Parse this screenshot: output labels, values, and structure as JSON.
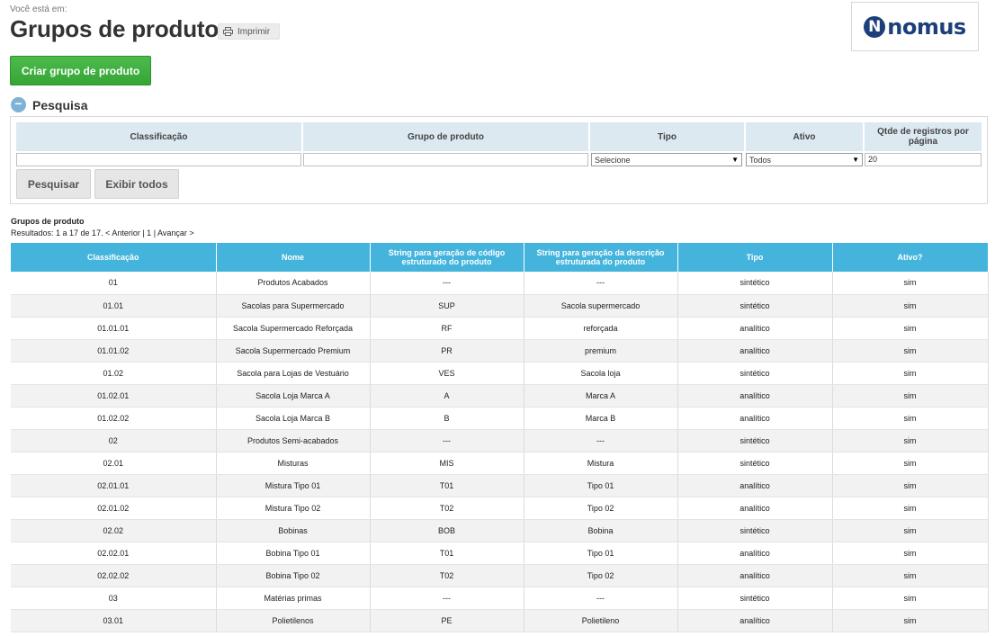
{
  "breadcrumb": "Você está em:",
  "title": "Grupos de produto",
  "print_label": "Imprimir",
  "logo_letter": "N",
  "logo_text": "nomus",
  "create_button": "Criar grupo de produto",
  "search": {
    "collapse_symbol": "−",
    "title": "Pesquisa",
    "labels": {
      "classificacao": "Classificação",
      "grupo": "Grupo de produto",
      "tipo": "Tipo",
      "ativo": "Ativo",
      "qtde": "Qtde de registros por página"
    },
    "values": {
      "classificacao": "",
      "grupo": "",
      "tipo": "Selecione",
      "ativo": "Todos",
      "qtde": "20"
    },
    "search_button": "Pesquisar",
    "show_all_button": "Exibir todos"
  },
  "results": {
    "title": "Grupos de produto",
    "summary": "Resultados: 1 a 17 de 17. < Anterior | 1 | Avançar >"
  },
  "table": {
    "headers": [
      "Classificação",
      "Nome",
      "String para geração de código estruturado do produto",
      "String para geração da descrição estruturada do produto",
      "Tipo",
      "Ativo?"
    ],
    "rows": [
      [
        "01",
        "Produtos Acabados",
        "---",
        "---",
        "sintético",
        "sim"
      ],
      [
        "01.01",
        "Sacolas para Supermercado",
        "SUP",
        "Sacola supermercado",
        "sintético",
        "sim"
      ],
      [
        "01.01.01",
        "Sacola Supermercado Reforçada",
        "RF",
        "reforçada",
        "analítico",
        "sim"
      ],
      [
        "01.01.02",
        "Sacola Supermercado Premium",
        "PR",
        "premium",
        "analítico",
        "sim"
      ],
      [
        "01.02",
        "Sacola para Lojas de Vestuário",
        "VES",
        "Sacola loja",
        "sintético",
        "sim"
      ],
      [
        "01.02.01",
        "Sacola Loja Marca A",
        "A",
        "Marca A",
        "analítico",
        "sim"
      ],
      [
        "01.02.02",
        "Sacola Loja Marca B",
        "B",
        "Marca B",
        "analítico",
        "sim"
      ],
      [
        "02",
        "Produtos Semi-acabados",
        "---",
        "---",
        "sintético",
        "sim"
      ],
      [
        "02.01",
        "Misturas",
        "MIS",
        "Mistura",
        "sintético",
        "sim"
      ],
      [
        "02.01.01",
        "Mistura Tipo 01",
        "T01",
        "Tipo 01",
        "analítico",
        "sim"
      ],
      [
        "02.01.02",
        "Mistura Tipo 02",
        "T02",
        "Tipo 02",
        "analítico",
        "sim"
      ],
      [
        "02.02",
        "Bobinas",
        "BOB",
        "Bobina",
        "sintético",
        "sim"
      ],
      [
        "02.02.01",
        "Bobina Tipo 01",
        "T01",
        "Tipo 01",
        "analítico",
        "sim"
      ],
      [
        "02.02.02",
        "Bobina Tipo 02",
        "T02",
        "Tipo 02",
        "analítico",
        "sim"
      ],
      [
        "03",
        "Matérias primas",
        "---",
        "---",
        "sintético",
        "sim"
      ],
      [
        "03.01",
        "Polietilenos",
        "PE",
        "Polietileno",
        "analítico",
        "sim"
      ]
    ]
  },
  "colors": {
    "header_blue": "#44b4dd",
    "filter_label_bg": "#dce9f1",
    "create_green": "#3db03d",
    "logo_navy": "#1c3f7a"
  }
}
